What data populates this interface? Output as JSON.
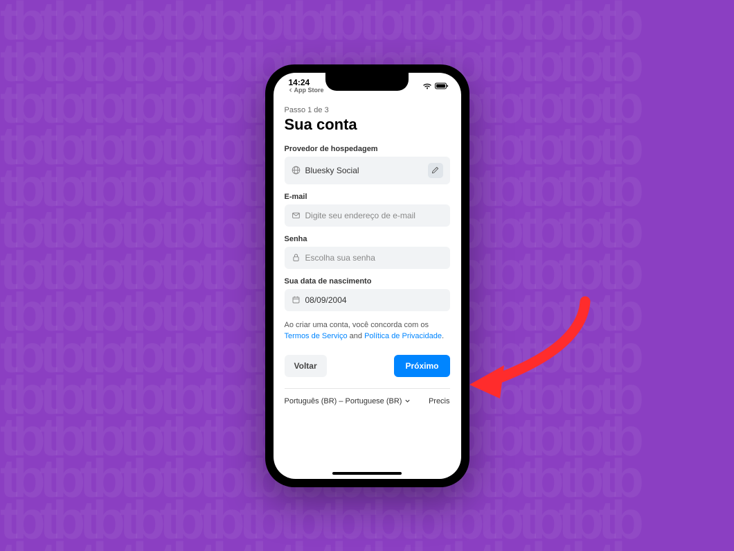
{
  "status_bar": {
    "time": "14:24",
    "back_text": "App Store"
  },
  "step": {
    "label": "Passo 1 de 3",
    "title": "Sua conta"
  },
  "fields": {
    "provider": {
      "label": "Provedor de hospedagem",
      "value": "Bluesky Social"
    },
    "email": {
      "label": "E-mail",
      "placeholder": "Digite seu endereço de e-mail"
    },
    "password": {
      "label": "Senha",
      "placeholder": "Escolha sua senha"
    },
    "birthdate": {
      "label": "Sua data de nascimento",
      "value": "08/09/2004"
    }
  },
  "terms": {
    "prefix": "Ao criar uma conta, você concorda com os ",
    "tos": "Termos de Serviço",
    "and": " and ",
    "privacy": "Política de Privacidade",
    "suffix": "."
  },
  "buttons": {
    "back": "Voltar",
    "next": "Próximo"
  },
  "footer": {
    "language": "Português (BR) – Portuguese (BR)",
    "help": "Precis"
  }
}
